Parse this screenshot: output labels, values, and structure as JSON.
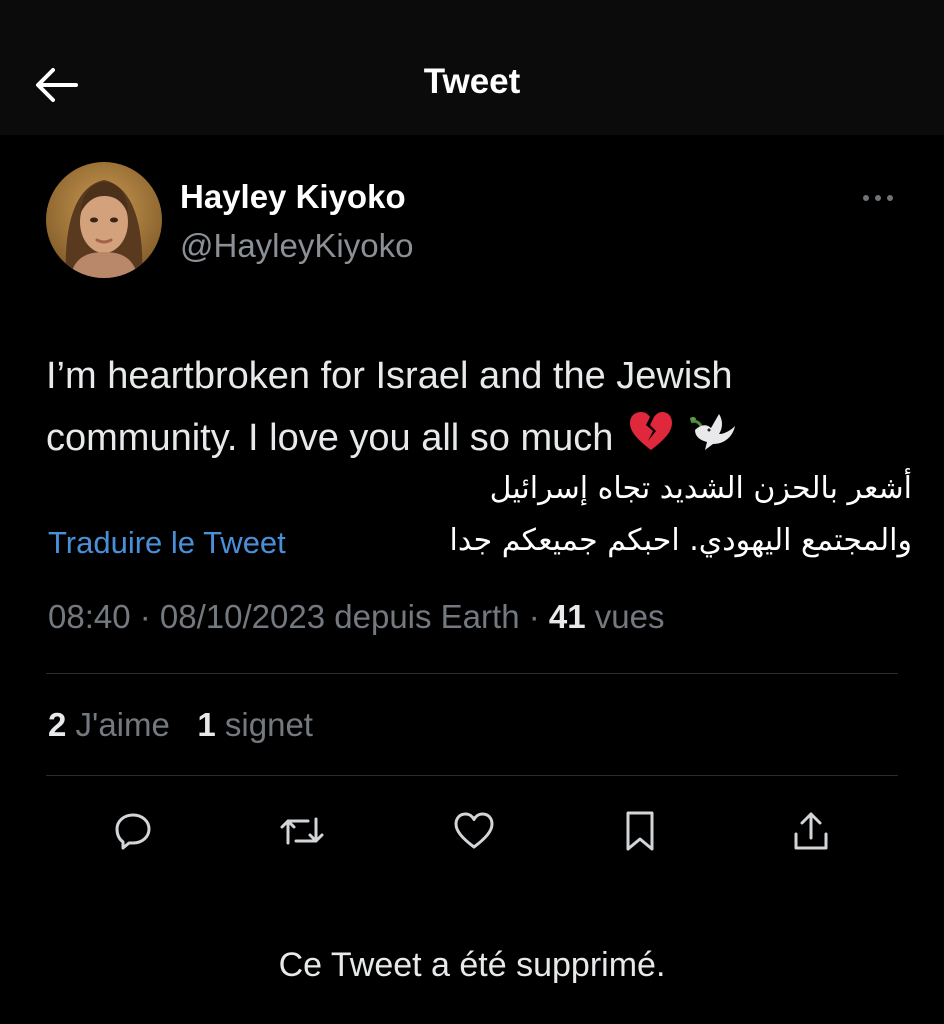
{
  "header": {
    "back_icon": "arrow-left-icon",
    "title": "Tweet"
  },
  "author": {
    "name": "Hayley Kiyoko",
    "handle": "@HayleyKiyoko",
    "more_icon": "more-dots-icon"
  },
  "tweet": {
    "line1": "I’m heartbroken for Israel and the Jewish",
    "line2": "community. I love you all so much",
    "emojis": [
      "broken-heart-icon",
      "dove-icon"
    ]
  },
  "arabic_overlay": {
    "line1": "أشعر بالحزن الشديد تجاه إسرائيل",
    "line2": "والمجتمع اليهودي. احبكم جميعكم جدا"
  },
  "translate_link": "Traduire le Tweet",
  "meta": {
    "time": "08:40",
    "sep1": " · ",
    "date": "08/10/2023",
    "source": " depuis Earth",
    "sep2": " · ",
    "views_count": "41",
    "views_label": " vues"
  },
  "stats": {
    "likes_count": "2",
    "likes_label": " J'aime",
    "bookmarks_count": "1",
    "bookmarks_label": " signet"
  },
  "actions": [
    "reply-icon",
    "retweet-icon",
    "like-icon",
    "bookmark-icon",
    "share-icon"
  ],
  "deleted_notice": "Ce Tweet a été supprimé.",
  "colors": {
    "background": "#000000",
    "header_bg": "#0b0b0b",
    "text": "#e7e9ea",
    "muted": "#74797f",
    "link": "#4a90d9",
    "divider": "#2a2c30"
  }
}
